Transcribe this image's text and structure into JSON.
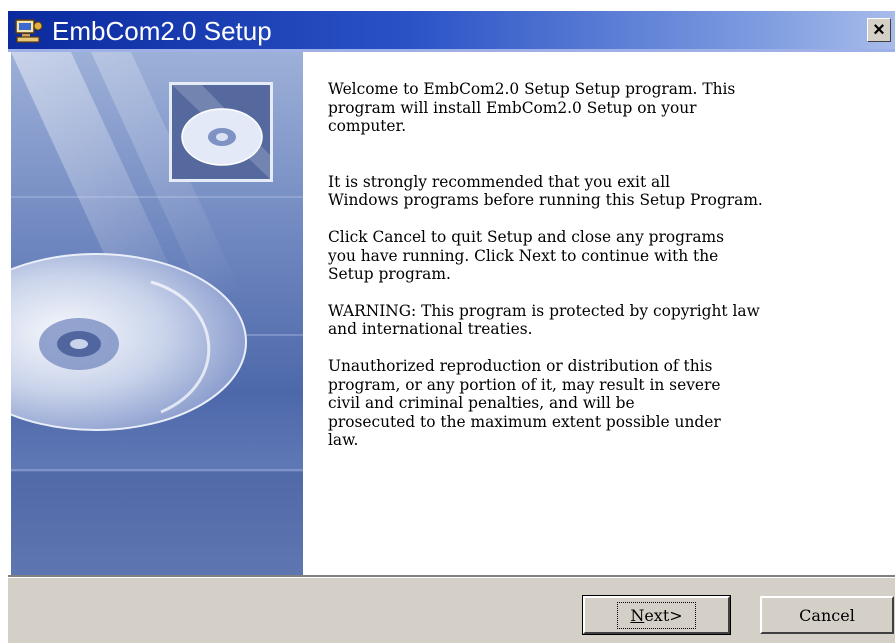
{
  "window": {
    "title": "EmbCom2.0 Setup",
    "close_label": "×"
  },
  "content": {
    "paragraphs": [
      "Welcome to EmbCom2.0 Setup Setup program. This\nprogram will install EmbCom2.0 Setup on your\ncomputer.",
      "It is strongly recommended that you exit all\nWindows programs before running this Setup Program.",
      "Click Cancel to quit Setup and close any programs\nyou have running.  Click Next to continue with the\nSetup program.",
      "WARNING: This program is protected by copyright law\nand international treaties.",
      "Unauthorized reproduction or distribution of this\nprogram, or any portion of it, may result in severe\ncivil and criminal penalties, and will be\nprosecuted to the maximum extent possible under\nlaw."
    ]
  },
  "buttons": {
    "next_mnemonic": "N",
    "next_rest": "ext>",
    "cancel": "Cancel"
  },
  "icons": {
    "title": "setup-computer-icon",
    "thumbnail": "cd-disc-icon",
    "side_image": "cd-disc-artwork"
  },
  "colors": {
    "titlebar_start": "#0a2a9e",
    "titlebar_end": "#a8bcea",
    "button_face": "#d4d0c8"
  }
}
